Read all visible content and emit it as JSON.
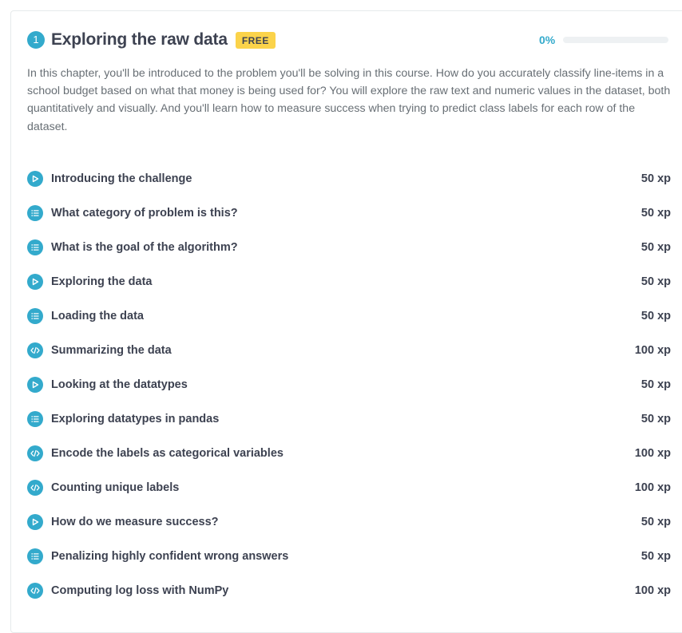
{
  "chapter": {
    "number": "1",
    "title": "Exploring the raw data",
    "badge": "FREE",
    "progress": {
      "label": "0%",
      "fraction": 0
    },
    "description": "In this chapter, you'll be introduced to the problem you'll be solving in this course. How do you accurately classify line-items in a school budget based on what that money is being used for? You will explore the raw text and numeric values in the dataset, both quantitatively and visually. And you'll learn how to measure success when trying to predict class labels for each row of the dataset."
  },
  "colors": {
    "accent": "#33aacc",
    "badge": "#fbd34a",
    "text": "#3d4251",
    "muted": "#686f75"
  },
  "exercises": [
    {
      "type": "video",
      "icon": "play-icon",
      "title": "Introducing the challenge",
      "xp": "50 xp"
    },
    {
      "type": "multiple-choice",
      "icon": "list-icon",
      "title": "What category of problem is this?",
      "xp": "50 xp"
    },
    {
      "type": "multiple-choice",
      "icon": "list-icon",
      "title": "What is the goal of the algorithm?",
      "xp": "50 xp"
    },
    {
      "type": "video",
      "icon": "play-icon",
      "title": "Exploring the data",
      "xp": "50 xp"
    },
    {
      "type": "multiple-choice",
      "icon": "list-icon",
      "title": "Loading the data",
      "xp": "50 xp"
    },
    {
      "type": "code",
      "icon": "code-icon",
      "title": "Summarizing the data",
      "xp": "100 xp"
    },
    {
      "type": "video",
      "icon": "play-icon",
      "title": "Looking at the datatypes",
      "xp": "50 xp"
    },
    {
      "type": "multiple-choice",
      "icon": "list-icon",
      "title": "Exploring datatypes in pandas",
      "xp": "50 xp"
    },
    {
      "type": "code",
      "icon": "code-icon",
      "title": "Encode the labels as categorical variables",
      "xp": "100 xp"
    },
    {
      "type": "code",
      "icon": "code-icon",
      "title": "Counting unique labels",
      "xp": "100 xp"
    },
    {
      "type": "video",
      "icon": "play-icon",
      "title": "How do we measure success?",
      "xp": "50 xp"
    },
    {
      "type": "multiple-choice",
      "icon": "list-icon",
      "title": "Penalizing highly confident wrong answers",
      "xp": "50 xp"
    },
    {
      "type": "code",
      "icon": "code-icon",
      "title": "Computing log loss with NumPy",
      "xp": "100 xp"
    }
  ]
}
